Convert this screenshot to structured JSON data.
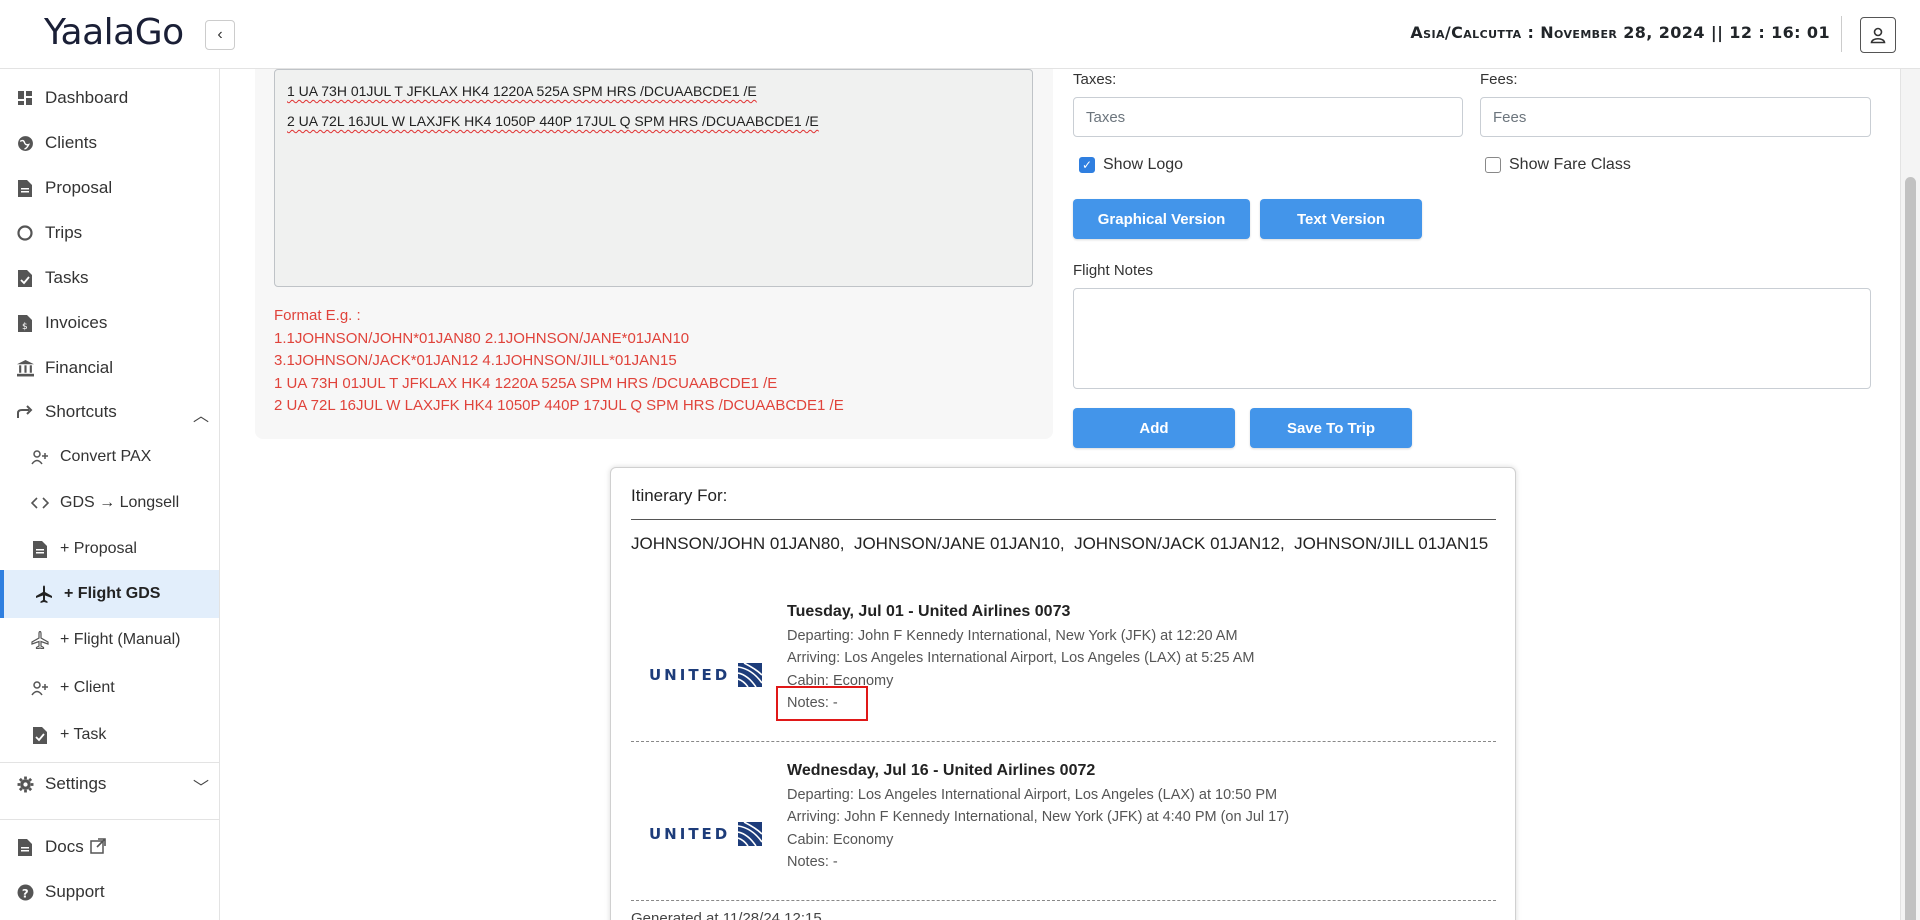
{
  "app": {
    "name": "YaalaGo"
  },
  "header": {
    "clock": "Asia/Calcutta : November 28, 2024 || 12 : 16: 01"
  },
  "sidebar": {
    "items": [
      {
        "label": "Dashboard"
      },
      {
        "label": "Clients"
      },
      {
        "label": "Proposal"
      },
      {
        "label": "Trips"
      },
      {
        "label": "Tasks"
      },
      {
        "label": "Invoices"
      },
      {
        "label": "Financial"
      },
      {
        "label": "Shortcuts"
      }
    ],
    "shortcuts": [
      {
        "label": "Convert PAX"
      },
      {
        "label": "GDS → Longsell"
      },
      {
        "label": "+ Proposal"
      },
      {
        "label": "+ Flight GDS"
      },
      {
        "label": "+ Flight (Manual)"
      },
      {
        "label": "+ Client"
      },
      {
        "label": "+ Task"
      }
    ],
    "settings": {
      "label": "Settings"
    },
    "docs": {
      "label": "Docs"
    },
    "support": {
      "label": "Support"
    }
  },
  "gds": {
    "lines": [
      "1 UA 73H 01JUL T JFKLAX HK4 1220A 525A SPM HRS /DCUAABCDE1 /E",
      "2 UA 72L 16JUL W LAXJFK HK4 1050P 440P 17JUL Q SPM HRS /DCUAABCDE1 /E"
    ],
    "format_title": "Format E.g. :",
    "format_lines": [
      "1.1JOHNSON/JOHN*01JAN80 2.1JOHNSON/JANE*01JAN10",
      "3.1JOHNSON/JACK*01JAN12 4.1JOHNSON/JILL*01JAN15",
      "1 UA 73H 01JUL T JFKLAX HK4 1220A 525A SPM HRS /DCUAABCDE1 /E",
      "2 UA 72L 16JUL W LAXJFK HK4 1050P 440P 17JUL Q SPM HRS /DCUAABCDE1 /E"
    ]
  },
  "form": {
    "taxes_label": "Taxes:",
    "taxes_placeholder": "Taxes",
    "fees_label": "Fees:",
    "fees_placeholder": "Fees",
    "show_logo": {
      "label": "Show Logo",
      "checked": true
    },
    "show_fare_class": {
      "label": "Show Fare Class",
      "checked": false
    },
    "graphical_btn": "Graphical Version",
    "text_btn": "Text Version",
    "flight_notes_label": "Flight Notes",
    "add_btn": "Add",
    "save_btn": "Save To Trip"
  },
  "itinerary": {
    "title": "Itinerary For:",
    "passengers": "JOHNSON/JOHN 01JAN80,  JOHNSON/JANE 01JAN10,  JOHNSON/JACK 01JAN12,  JOHNSON/JILL 01JAN15",
    "airline_logo_text": "UNITED",
    "segments": [
      {
        "title": "Tuesday, Jul 01 - United Airlines 0073",
        "departing": "Departing: John F Kennedy International, New York (JFK) at 12:20 AM",
        "arriving": "Arriving: Los Angeles International Airport, Los Angeles (LAX) at 5:25 AM",
        "cabin": "Cabin: Economy",
        "notes": "Notes: -"
      },
      {
        "title": "Wednesday, Jul 16 - United Airlines 0072",
        "departing": "Departing: Los Angeles International Airport, Los Angeles (LAX) at 10:50 PM",
        "arriving": "Arriving: John F Kennedy International, New York (JFK) at 4:40 PM (on Jul 17)",
        "cabin": "Cabin: Economy",
        "notes": "Notes: -"
      }
    ],
    "generated": "Generated at 11/28/24 12:15"
  },
  "colors": {
    "accent": "#4395ea",
    "format_text": "#e0433b",
    "active_bg": "#e2eefb",
    "highlight": "#e01818",
    "united": "#1d3c7a"
  }
}
